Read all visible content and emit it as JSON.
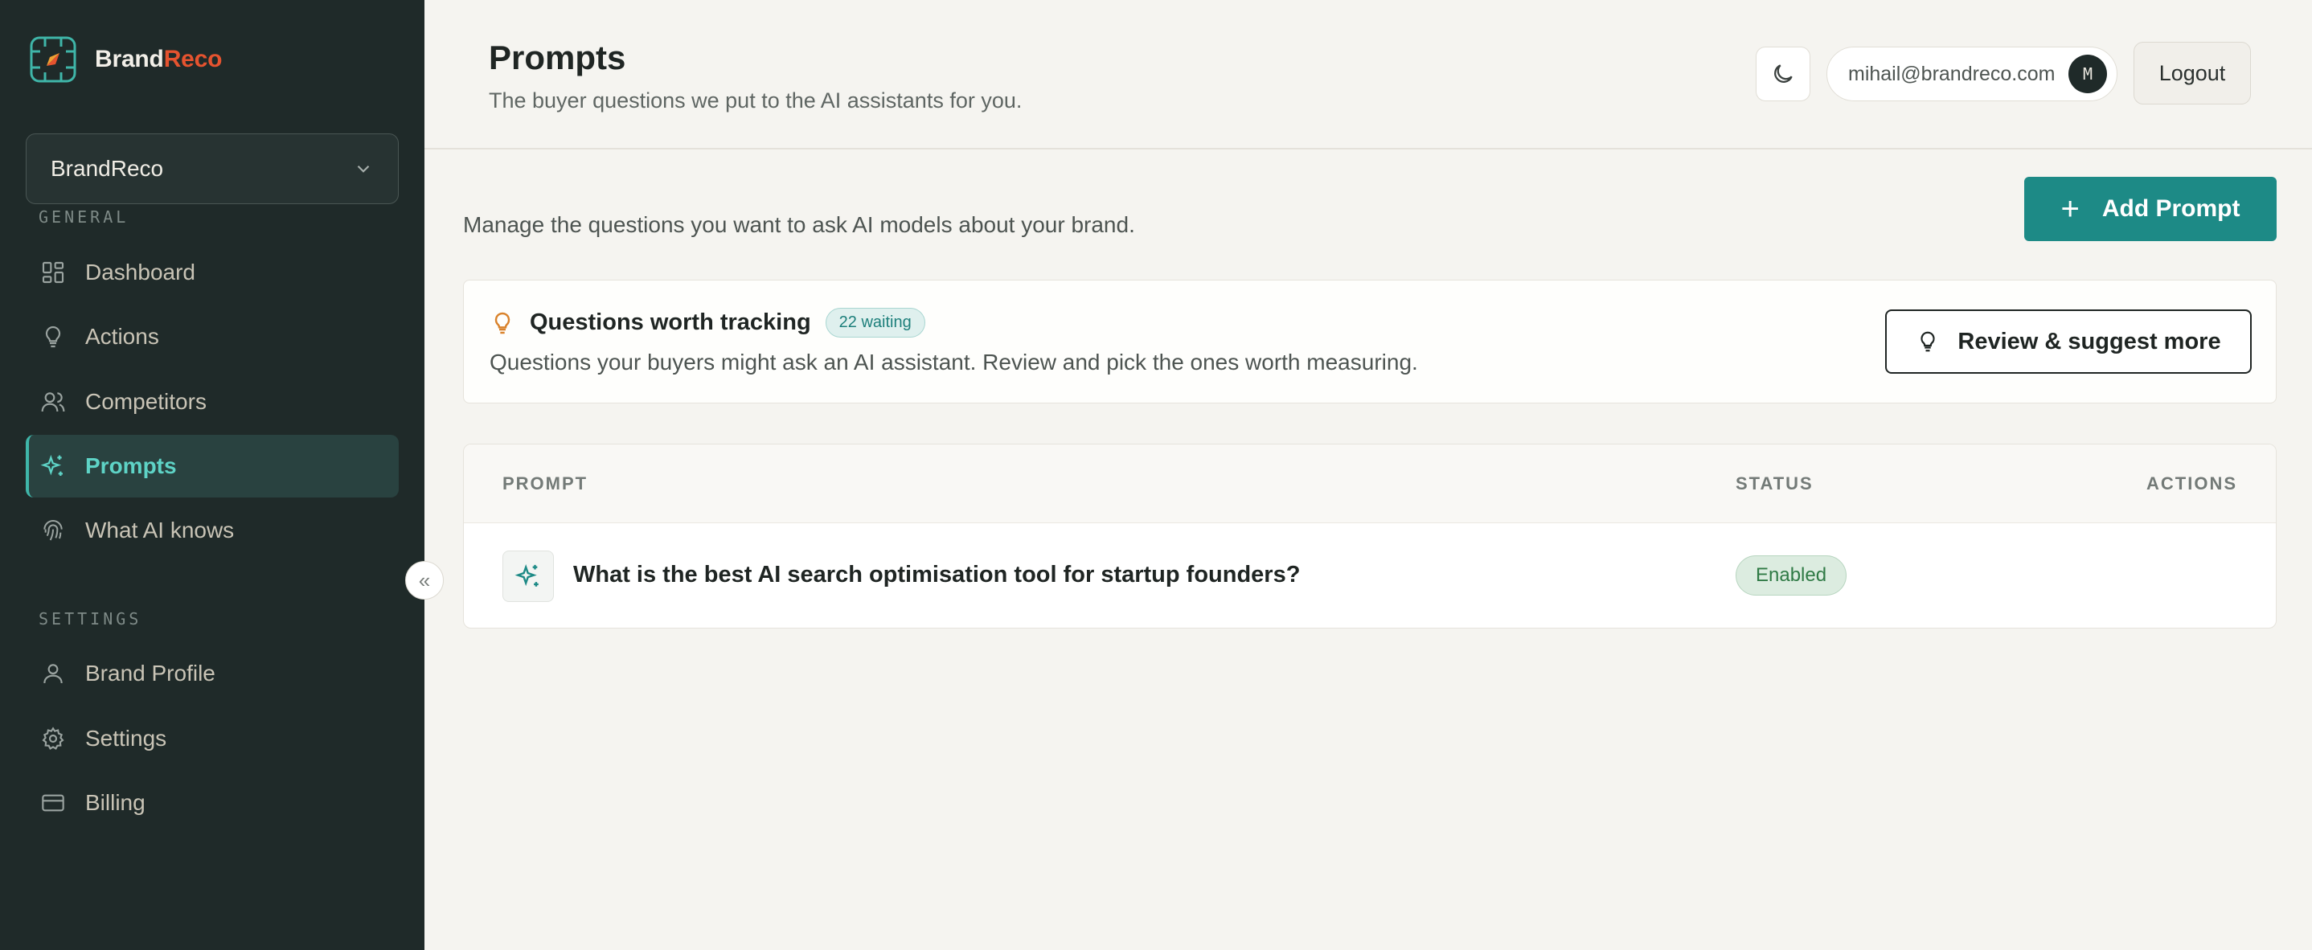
{
  "brand": {
    "name_part1": "Brand",
    "name_part2": "Reco"
  },
  "brand_select": {
    "value": "BrandReco"
  },
  "sidebar": {
    "general_label": "GENERAL",
    "settings_label": "SETTINGS",
    "general_items": [
      {
        "label": "Dashboard",
        "icon": "dashboard-grid-icon"
      },
      {
        "label": "Actions",
        "icon": "lightbulb-icon"
      },
      {
        "label": "Competitors",
        "icon": "users-icon"
      },
      {
        "label": "Prompts",
        "icon": "sparkles-icon",
        "active": true
      },
      {
        "label": "What AI knows",
        "icon": "fingerprint-icon"
      }
    ],
    "settings_items": [
      {
        "label": "Brand Profile",
        "icon": "user-icon"
      },
      {
        "label": "Settings",
        "icon": "gear-icon"
      },
      {
        "label": "Billing",
        "icon": "credit-card-icon"
      }
    ],
    "collapse_glyph": "«"
  },
  "header": {
    "title": "Prompts",
    "subtitle": "The buyer questions we put to the AI assistants for you.",
    "user_email": "mihail@brandreco.com",
    "avatar_initial": "M",
    "logout_label": "Logout"
  },
  "main": {
    "intro": "Manage the questions you want to ask AI models about your brand.",
    "add_button_label": "Add Prompt",
    "suggest": {
      "title": "Questions worth tracking",
      "badge": "22 waiting",
      "description": "Questions your buyers might ask an AI assistant. Review and pick the ones worth measuring.",
      "button_label": "Review & suggest more"
    },
    "table": {
      "columns": [
        "PROMPT",
        "STATUS",
        "ACTIONS"
      ],
      "rows": [
        {
          "prompt": "What is the best AI search optimisation tool for startup founders?",
          "status": "Enabled"
        }
      ]
    }
  },
  "colors": {
    "sidebar_bg": "#1f2a29",
    "accent_teal": "#1d8a86",
    "active_nav_text": "#5ed3c6",
    "brand_orange": "#e5532f",
    "status_green": "#2f7a45"
  }
}
